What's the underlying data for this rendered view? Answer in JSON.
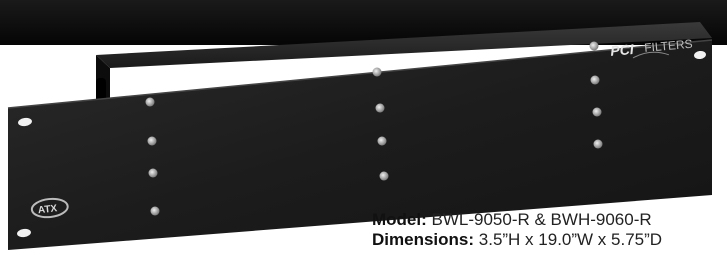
{
  "product": {
    "brand_badge": "PCI FILTERS",
    "maker_logo": "ATX",
    "colors": {
      "chassis": "#1e1e1e",
      "background_band": "#101010",
      "screw": "#c8c8c8"
    }
  },
  "specs": {
    "model_label": "Model:",
    "model_value": "BWL-9050-R & BWH-9060-R",
    "dimensions_label": "Dimensions:",
    "dimensions_value": "3.5”H x 19.0”W x 5.75”D"
  }
}
